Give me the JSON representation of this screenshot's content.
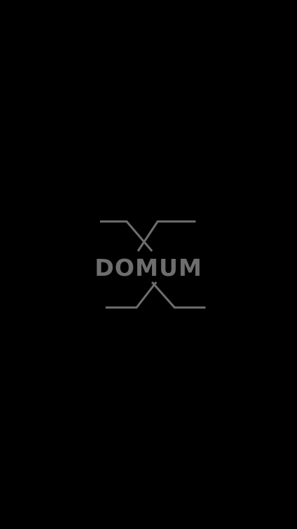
{
  "splash": {
    "logo_icon": "domum-x-logo-icon",
    "brand_name": "DOMUM"
  },
  "colors": {
    "background": "#000000",
    "logo": "#6e6e6e"
  }
}
